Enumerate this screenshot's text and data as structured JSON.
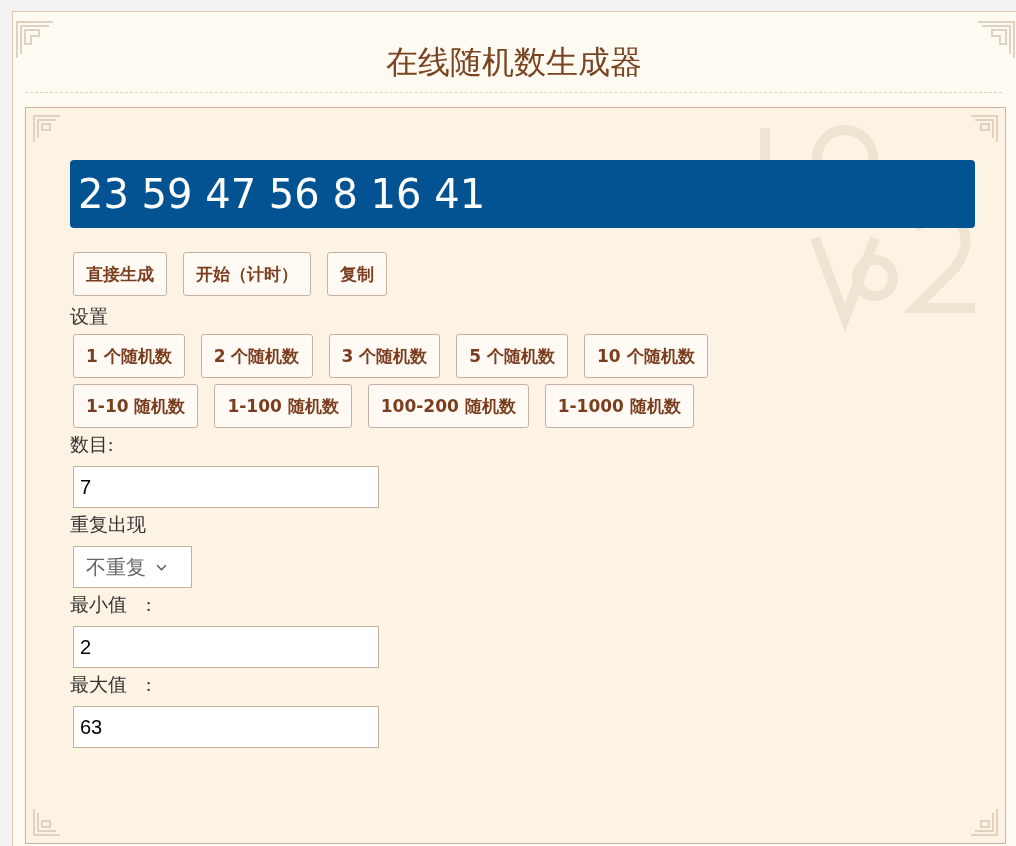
{
  "title": "在线随机数生成器",
  "result": "23 59 47 56 8 16 41",
  "actions": [
    "直接生成",
    "开始（计时）",
    "复制"
  ],
  "settings_label": "设置",
  "preset_rows": [
    [
      "1 个随机数",
      "2 个随机数",
      "3 个随机数",
      "5 个随机数",
      "10 个随机数"
    ],
    [
      "1-10 随机数",
      "1-100 随机数",
      "100-200 随机数",
      "1-1000 随机数"
    ]
  ],
  "fields": [
    {
      "kind": "input",
      "label": "数目:",
      "value": "7"
    },
    {
      "kind": "select",
      "label": "重复出现",
      "value": "不重复"
    },
    {
      "kind": "input",
      "label": "最小值　:",
      "value": "2"
    },
    {
      "kind": "input",
      "label": "最大值　:",
      "value": "63"
    }
  ]
}
